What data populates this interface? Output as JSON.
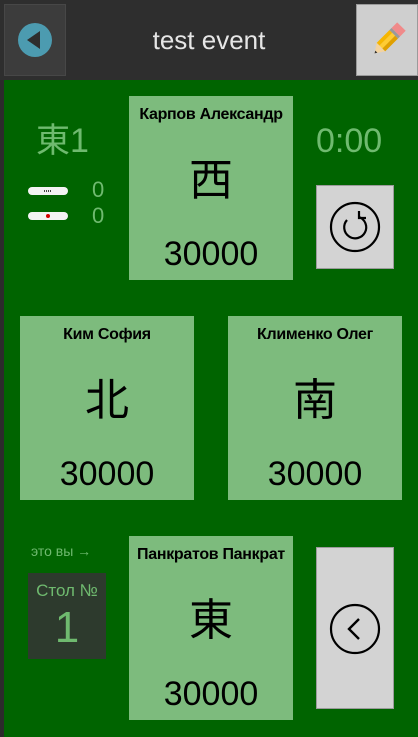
{
  "header": {
    "title": "test event",
    "back_icon": "back-arrow-icon",
    "edit_icon": "pencil-icon"
  },
  "round": {
    "label": "東1",
    "timer": "0:00"
  },
  "sticks": {
    "thousand_count": "0",
    "hundred_count": "0"
  },
  "players": {
    "top": {
      "name": "Карпов Александр",
      "wind": "西",
      "score": "30000"
    },
    "left": {
      "name": "Ким София",
      "wind": "北",
      "score": "30000"
    },
    "right": {
      "name": "Клименко Олег",
      "wind": "南",
      "score": "30000"
    },
    "bottom": {
      "name": "Панкратов Панкрат",
      "wind": "東",
      "score": "30000"
    }
  },
  "self": {
    "you_label": "это вы →",
    "table_label": "Стол №",
    "table_number": "1"
  },
  "buttons": {
    "refresh_icon": "refresh-icon",
    "prev_icon": "chevron-left-icon"
  },
  "colors": {
    "board": "#006400",
    "card": "#7dbb7d",
    "accent_text": "#6fba6f",
    "header": "#2e2e2e"
  }
}
